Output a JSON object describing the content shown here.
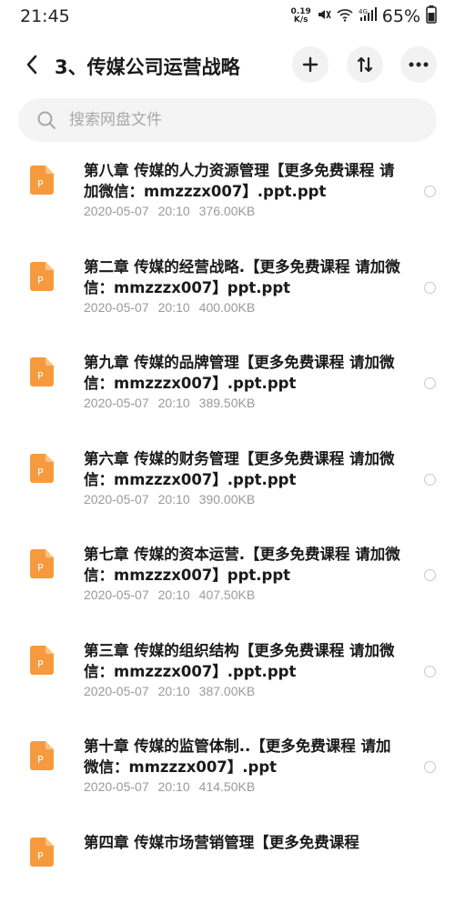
{
  "status": {
    "time": "21:45",
    "net_speed_value": "0.19",
    "net_speed_unit": "K/s",
    "battery": "65%"
  },
  "header": {
    "title": "3、传媒公司运营战略"
  },
  "search": {
    "placeholder": "搜索网盘文件"
  },
  "files": [
    {
      "name": "第八章 传媒的人力资源管理【更多免费课程 请加微信：mmzzzx007】.ppt.ppt",
      "date": "2020-05-07",
      "time": "20:10",
      "size": "376.00KB"
    },
    {
      "name": "第二章 传媒的经营战略.【更多免费课程 请加微信：mmzzzx007】ppt.ppt",
      "date": "2020-05-07",
      "time": "20:10",
      "size": "400.00KB"
    },
    {
      "name": "第九章 传媒的品牌管理【更多免费课程 请加微信：mmzzzx007】.ppt.ppt",
      "date": "2020-05-07",
      "time": "20:10",
      "size": "389.50KB"
    },
    {
      "name": "第六章 传媒的财务管理【更多免费课程 请加微信：mmzzzx007】.ppt.ppt",
      "date": "2020-05-07",
      "time": "20:10",
      "size": "390.00KB"
    },
    {
      "name": "第七章 传媒的资本运营.【更多免费课程 请加微信：mmzzzx007】ppt.ppt",
      "date": "2020-05-07",
      "time": "20:10",
      "size": "407.50KB"
    },
    {
      "name": "第三章 传媒的组织结构【更多免费课程 请加微信：mmzzzx007】.ppt.ppt",
      "date": "2020-05-07",
      "time": "20:10",
      "size": "387.00KB"
    },
    {
      "name": "第十章 传媒的监管体制..【更多免费课程 请加微信：mmzzzx007】.ppt",
      "date": "2020-05-07",
      "time": "20:10",
      "size": "414.50KB"
    },
    {
      "name": "第四章 传媒市场营销管理【更多免费课程",
      "date": "",
      "time": "",
      "size": ""
    }
  ],
  "colors": {
    "file_icon": "#f79a3e",
    "meta_text": "#9a9a9a"
  },
  "icons": {
    "back": "chevron-left-icon",
    "add": "plus-icon",
    "sort": "sort-icon",
    "more": "more-icon",
    "search": "search-icon",
    "file": "ppt-file-icon"
  }
}
